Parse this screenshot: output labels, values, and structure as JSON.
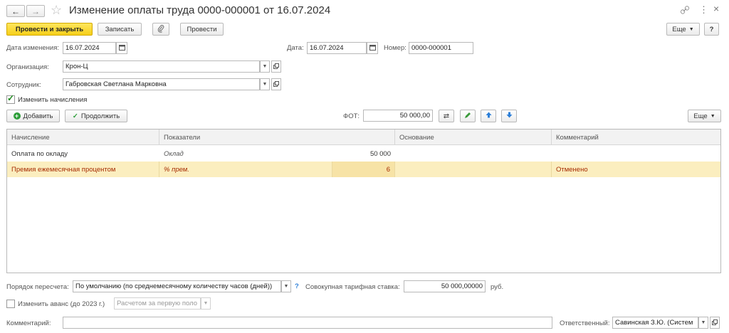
{
  "window": {
    "title": "Изменение оплаты труда 0000-000001 от 16.07.2024",
    "nav_back": "←",
    "nav_forward": "→",
    "star": "☆",
    "link_icon": "link-icon",
    "more_icon": "⋮",
    "close": "×"
  },
  "toolbar": {
    "post_close": "Провести и закрыть",
    "save": "Записать",
    "attach_icon": "paperclip-icon",
    "post": "Провести",
    "more": "Еще",
    "help": "?"
  },
  "header": {
    "change_date_label": "Дата изменения:",
    "change_date_value": "16.07.2024",
    "date_label": "Дата:",
    "date_value": "16.07.2024",
    "number_label": "Номер:",
    "number_value": "0000-000001",
    "org_label": "Организация:",
    "org_value": "Крон-Ц",
    "employee_label": "Сотрудник:",
    "employee_value": "Габровская Светлана Марковна",
    "change_accruals_label": "Изменить начисления",
    "change_accruals_checked": true
  },
  "accruals_toolbar": {
    "add": "Добавить",
    "continue": "Продолжить",
    "fot_label": "ФОТ:",
    "fot_value": "50 000,00",
    "more": "Еще"
  },
  "table": {
    "columns": [
      "Начисление",
      "Показатели",
      "Основание",
      "Комментарий"
    ],
    "rows": [
      {
        "accrual": "Оплата по окладу",
        "indicator": "Оклад",
        "value": "50 000",
        "basis": "",
        "comment": "",
        "selected": false
      },
      {
        "accrual": "Премия ежемесячная процентом",
        "indicator": "% прем.",
        "value": "6",
        "basis": "",
        "comment": "Отменено",
        "selected": true
      }
    ]
  },
  "footer": {
    "recalc_label": "Порядок пересчета:",
    "recalc_value": "По умолчанию (по среднемесячному количеству часов (дней))",
    "help": "?",
    "rate_label": "Совокупная тарифная ставка:",
    "rate_value": "50 000,00000",
    "rate_unit": "руб.",
    "advance_label": "Изменить аванс (до 2023 г.)",
    "advance_value": "Расчетом за первую поло",
    "comment_label": "Комментарий:",
    "comment_value": "",
    "responsible_label": "Ответственный:",
    "responsible_value": "Савинская З.Ю. (Систем"
  },
  "colors": {
    "primary_button": "#f6cf1a",
    "selected_row": "#fbeebf",
    "selected_text": "#a52a00"
  }
}
